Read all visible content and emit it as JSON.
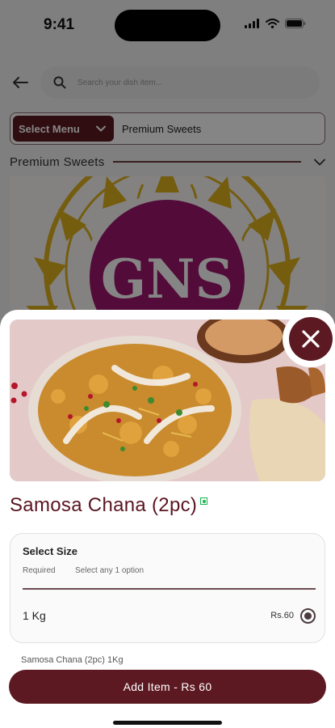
{
  "status_bar": {
    "time": "9:41"
  },
  "header": {
    "search_placeholder": "Search your dish item..."
  },
  "menu_selector": {
    "button_label": "Select Menu",
    "current_menu": "Premium Sweets"
  },
  "section": {
    "title": "Premium Sweets"
  },
  "banner": {
    "logo_text": "GNS"
  },
  "dish": {
    "name": "Samosa Chana (2pc)",
    "select_size": {
      "title": "Select Size",
      "required_label": "Required",
      "hint": "Select any 1 option",
      "options": [
        {
          "label": "1 Kg",
          "price": "Rs.60",
          "selected": true
        }
      ]
    },
    "summary": "Samosa Chana (2pc) 1Kg",
    "add_button_label": "Add Item - Rs 60"
  },
  "colors": {
    "brand": "#5d1922",
    "veg": "#18b34d",
    "logo_magenta": "#a0166e",
    "logo_gold": "#e1b31f"
  }
}
